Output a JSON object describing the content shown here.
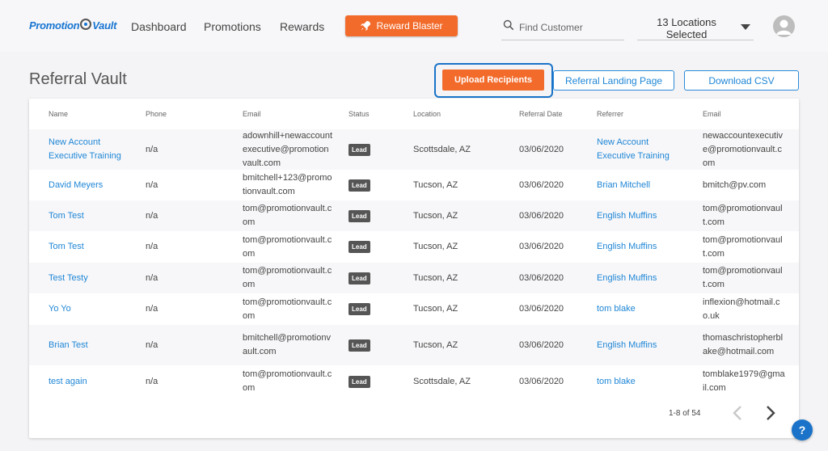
{
  "header": {
    "logo": "Promotion Vault",
    "nav": [
      "Dashboard",
      "Promotions",
      "Rewards"
    ],
    "reward_blaster": "Reward Blaster",
    "search_placeholder": "Find Customer",
    "locations_line1": "13 Locations",
    "locations_line2": "Selected"
  },
  "page": {
    "title": "Referral Vault",
    "upload_button": "Upload Recipients",
    "landing_button": "Referral Landing Page",
    "download_button": "Download CSV"
  },
  "table": {
    "headers": [
      "Name",
      "Phone",
      "Email",
      "Status",
      "Location",
      "Referral Date",
      "Referrer",
      "Email"
    ],
    "rows": [
      {
        "name": "New Account Executive Training",
        "phone": "n/a",
        "email": "adownhill+newaccountexecutive@promotionvault.com",
        "status": "Lead",
        "location": "Scottsdale, AZ",
        "date": "03/06/2020",
        "referrer": "New Account Executive Training",
        "ref_email": "newaccountexecutive@promotionvault.com"
      },
      {
        "name": "David Meyers",
        "phone": "n/a",
        "email": "bmitchell+123@promotionvault.com",
        "status": "Lead",
        "location": "Tucson, AZ",
        "date": "03/06/2020",
        "referrer": "Brian Mitchell",
        "ref_email": "bmitch@pv.com"
      },
      {
        "name": "Tom Test",
        "phone": "n/a",
        "email": "tom@promotionvault.com",
        "status": "Lead",
        "location": "Tucson, AZ",
        "date": "03/06/2020",
        "referrer": "English Muffins",
        "ref_email": "tom@promotionvault.com"
      },
      {
        "name": "Tom Test",
        "phone": "n/a",
        "email": "tom@promotionvault.com",
        "status": "Lead",
        "location": "Tucson, AZ",
        "date": "03/06/2020",
        "referrer": "English Muffins",
        "ref_email": "tom@promotionvault.com"
      },
      {
        "name": "Test Testy",
        "phone": "n/a",
        "email": "tom@promotionvault.com",
        "status": "Lead",
        "location": "Tucson, AZ",
        "date": "03/06/2020",
        "referrer": "English Muffins",
        "ref_email": "tom@promotionvault.com"
      },
      {
        "name": "Yo Yo",
        "phone": "n/a",
        "email": "tom@promotionvault.com",
        "status": "Lead",
        "location": "Tucson, AZ",
        "date": "03/06/2020",
        "referrer": "tom blake",
        "ref_email": "inflexion@hotmail.co.uk"
      },
      {
        "name": "Brian Test",
        "phone": "n/a",
        "email": "bmitchell@promotionvault.com",
        "status": "Lead",
        "location": "Tucson, AZ",
        "date": "03/06/2020",
        "referrer": "English Muffins",
        "ref_email": "thomaschristopherblake@hotmail.com"
      },
      {
        "name": "test again",
        "phone": "n/a",
        "email": "tom@promotionvault.com",
        "status": "Lead",
        "location": "Scottsdale, AZ",
        "date": "03/06/2020",
        "referrer": "tom blake",
        "ref_email": "tomblake1979@gmail.com"
      }
    ]
  },
  "pagination": {
    "range": "1-8 of 54"
  },
  "help": {
    "label": "?"
  },
  "colors": {
    "accent": "#f26b2b",
    "link": "#1f86d6",
    "focus": "#1a73c8",
    "badge": "#555555"
  }
}
